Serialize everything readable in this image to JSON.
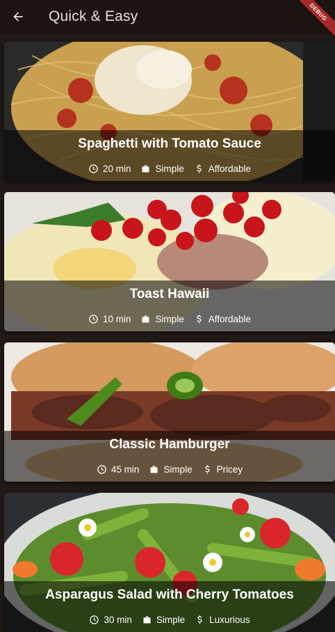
{
  "appbar": {
    "title": "Quick & Easy",
    "back_icon": "arrow-back-icon"
  },
  "debug_banner": "DEBUG",
  "meals": [
    {
      "title": "Spaghetti with Tomato Sauce",
      "duration": "20 min",
      "complexity": "Simple",
      "affordability": "Affordable"
    },
    {
      "title": "Toast Hawaii",
      "duration": "10 min",
      "complexity": "Simple",
      "affordability": "Affordable"
    },
    {
      "title": "Classic Hamburger",
      "duration": "45 min",
      "complexity": "Simple",
      "affordability": "Pricey"
    },
    {
      "title": "Asparagus Salad with Cherry Tomatoes",
      "duration": "30 min",
      "complexity": "Simple",
      "affordability": "Luxurious"
    }
  ],
  "icons": {
    "duration": "schedule-icon",
    "complexity": "work-icon",
    "affordability": "attach-money-icon"
  }
}
